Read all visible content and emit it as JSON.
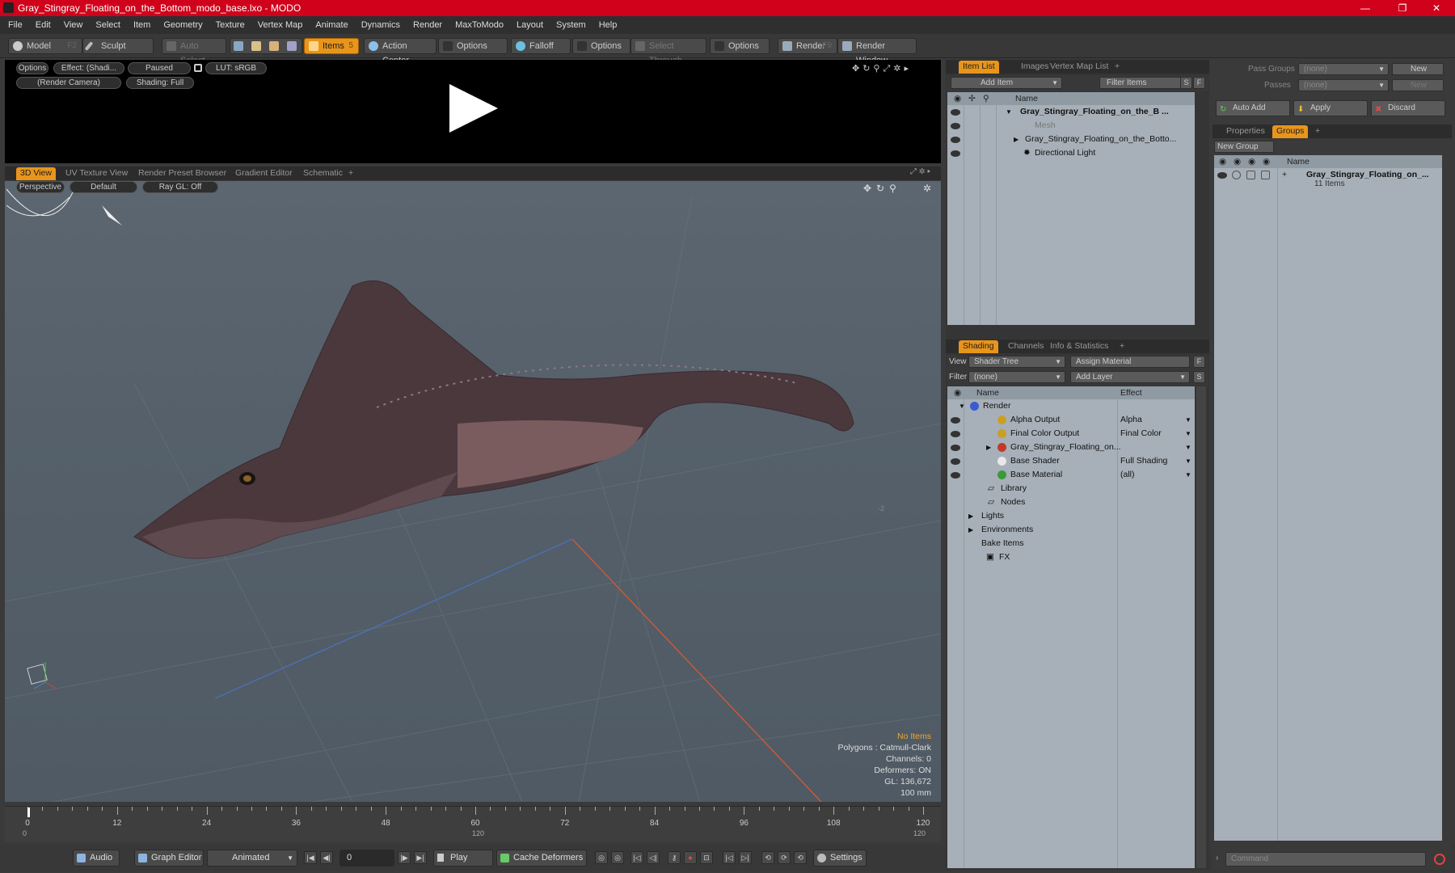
{
  "window": {
    "title": "Gray_Stingray_Floating_on_the_Bottom_modo_base.lxo - MODO",
    "minimize": "—",
    "maximize": "❐",
    "close": "✕"
  },
  "menu": [
    "File",
    "Edit",
    "View",
    "Select",
    "Item",
    "Geometry",
    "Texture",
    "Vertex Map",
    "Animate",
    "Dynamics",
    "Render",
    "MaxToModo",
    "Layout",
    "System",
    "Help"
  ],
  "toolbar": {
    "model": "Model",
    "model_key": "F2",
    "sculpt": "Sculpt",
    "auto_select": "Auto Select",
    "items": "Items",
    "items_key": "5",
    "action_center": "Action Center",
    "options1": "Options",
    "falloff": "Falloff",
    "options2": "Options",
    "select_through": "Select Through",
    "options3": "Options",
    "render": "Render",
    "render_key": "F9",
    "render_window": "Render Window"
  },
  "preview": {
    "options": "Options",
    "effect": "Effect: (Shadi...",
    "paused": "Paused",
    "lut": "LUT: sRGB",
    "camera": "(Render Camera)",
    "shading": "Shading: Full"
  },
  "viewport_tabs": [
    "3D View",
    "UV Texture View",
    "Render Preset Browser",
    "Gradient Editor",
    "Schematic",
    "+"
  ],
  "viewport": {
    "perspective": "Perspective",
    "default": "Default",
    "raygl": "Ray GL: Off",
    "info": {
      "no_items": "No Items",
      "polygons": "Polygons : Catmull-Clark",
      "channels": "Channels: 0",
      "deformers": "Deformers: ON",
      "gl": "GL: 136,672",
      "scale": "100 mm"
    },
    "side_mark": "-2"
  },
  "timeline": {
    "labels": [
      "0",
      "12",
      "24",
      "36",
      "48",
      "60",
      "72",
      "84",
      "96",
      "108",
      "120"
    ],
    "start": "0",
    "end": "120"
  },
  "playbar": {
    "audio": "Audio",
    "graph_editor": "Graph Editor",
    "animated": "Animated",
    "frame": "0",
    "play": "Play",
    "cache": "Cache Deformers",
    "settings": "Settings"
  },
  "item_list": {
    "tabs": [
      "Item List",
      "Images",
      "Vertex Map List",
      "+"
    ],
    "add_item": "Add Item",
    "filter": "Filter Items",
    "s": "S",
    "f": "F",
    "col_name": "Name",
    "rows": [
      "Gray_Stingray_Floating_on_the_B ...",
      "Mesh",
      "Gray_Stingray_Floating_on_the_Botto...",
      "Directional Light"
    ]
  },
  "shading": {
    "tabs": [
      "Shading",
      "Channels",
      "Info & Statistics",
      "+"
    ],
    "view_label": "View",
    "view_value": "Shader Tree",
    "assign": "Assign Material",
    "filter_label": "Filter",
    "filter_value": "(none)",
    "add_layer": "Add Layer",
    "f": "F",
    "s": "S",
    "col_name": "Name",
    "col_effect": "Effect",
    "rows": [
      {
        "name": "Render",
        "effect": ""
      },
      {
        "name": "Alpha Output",
        "effect": "Alpha"
      },
      {
        "name": "Final Color Output",
        "effect": "Final Color"
      },
      {
        "name": "Gray_Stingray_Floating_on...",
        "effect": ""
      },
      {
        "name": "Base Shader",
        "effect": "Full Shading"
      },
      {
        "name": "Base Material",
        "effect": "(all)"
      },
      {
        "name": "Library",
        "effect": ""
      },
      {
        "name": "Nodes",
        "effect": ""
      },
      {
        "name": "Lights",
        "effect": ""
      },
      {
        "name": "Environments",
        "effect": ""
      },
      {
        "name": "Bake Items",
        "effect": ""
      },
      {
        "name": "FX",
        "effect": ""
      }
    ]
  },
  "groups": {
    "pass_groups": "Pass Groups",
    "pass_value": "(none)",
    "passes": "Passes",
    "passes_value": "(none)",
    "new": "New",
    "auto_add": "Auto Add",
    "apply": "Apply",
    "discard": "Discard",
    "tabs": [
      "Properties",
      "Groups",
      "+"
    ],
    "new_group": "New Group",
    "col_name": "Name",
    "row_name": "Gray_Stingray_Floating_on_...",
    "row_count": "11 Items"
  },
  "command": {
    "placeholder": "Command"
  }
}
